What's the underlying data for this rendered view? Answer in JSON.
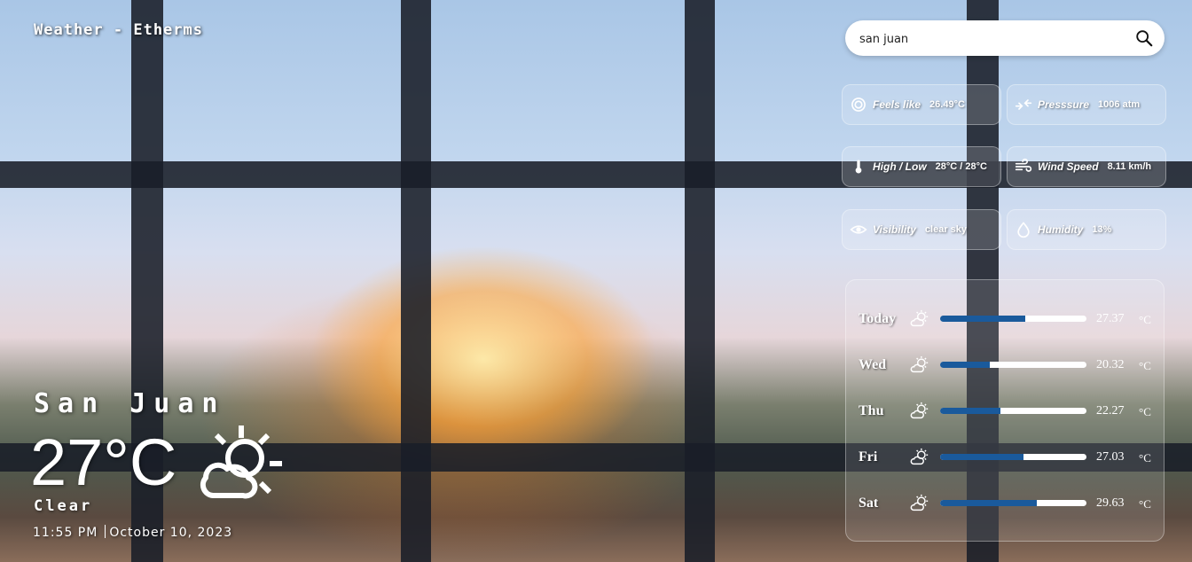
{
  "app": {
    "title": "Weather - Etherms"
  },
  "search": {
    "value": "san juan",
    "icon": "search-icon"
  },
  "details": [
    {
      "icon": "feels-like-icon",
      "label": "Feels like",
      "value": "26.49°C"
    },
    {
      "icon": "pressure-icon",
      "label": "Presssure",
      "value": "1006 atm"
    },
    {
      "icon": "thermometer-icon",
      "label": "High / Low",
      "value": "28°C / 28°C"
    },
    {
      "icon": "wind-icon",
      "label": "Wind Speed",
      "value": "8.11 km/h"
    },
    {
      "icon": "eye-icon",
      "label": "Visibility",
      "value": "clear sky"
    },
    {
      "icon": "droplet-icon",
      "label": "Humidity",
      "value": "13%"
    }
  ],
  "forecast": [
    {
      "day": "Today",
      "temp": "27.37",
      "unit": "°C",
      "level": 0.58,
      "icon": "partly-sunny-icon"
    },
    {
      "day": "Wed",
      "temp": "20.32",
      "unit": "°C",
      "level": 0.34,
      "icon": "partly-sunny-icon"
    },
    {
      "day": "Thu",
      "temp": "22.27",
      "unit": "°C",
      "level": 0.41,
      "icon": "partly-sunny-icon"
    },
    {
      "day": "Fri",
      "temp": "27.03",
      "unit": "°C",
      "level": 0.57,
      "icon": "partly-sunny-icon"
    },
    {
      "day": "Sat",
      "temp": "29.63",
      "unit": "°C",
      "level": 0.66,
      "icon": "partly-sunny-icon"
    }
  ],
  "current": {
    "city": "San Juan",
    "temp": "27°C",
    "condition": "Clear",
    "time": "11:55 PM",
    "date": "October 10, 2023",
    "icon": "partly-sunny-icon"
  },
  "colors": {
    "bar_fill": "#1a5a9c",
    "bar_track": "#ffffff",
    "card_bg": "rgba(255,255,255,0.16)"
  }
}
